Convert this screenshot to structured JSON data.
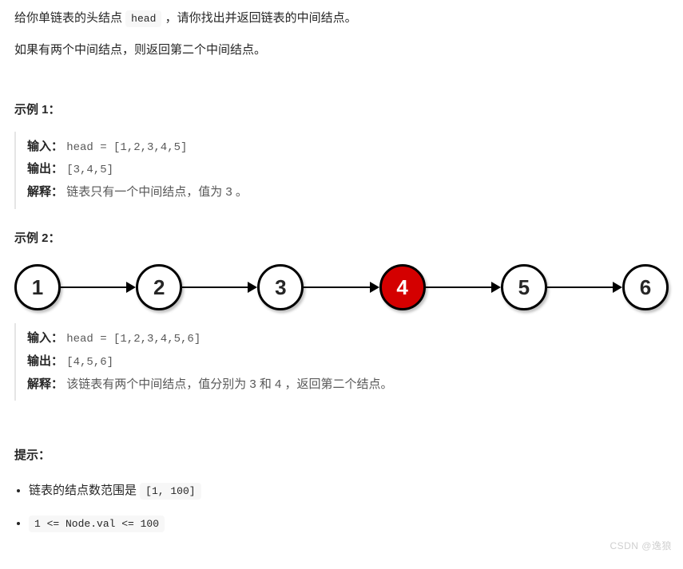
{
  "intro": {
    "p1_pre": "给你单链表的头结点 ",
    "p1_code": "head",
    "p1_post": " ，请你找出并返回链表的中间结点。",
    "p2": "如果有两个中间结点，则返回第二个中间结点。"
  },
  "example1": {
    "title": "示例 1：",
    "input_label": "输入：",
    "input_value": "head = [1,2,3,4,5]",
    "output_label": "输出：",
    "output_value": "[3,4,5]",
    "explain_label": "解释：",
    "explain_text": "链表只有一个中间结点，值为 3 。"
  },
  "example2": {
    "title": "示例 2：",
    "input_label": "输入：",
    "input_value": "head = [1,2,3,4,5,6]",
    "output_label": "输出：",
    "output_value": "[4,5,6]",
    "explain_label": "解释：",
    "explain_text": "该链表有两个中间结点，值分别为 3 和 4 ，返回第二个结点。"
  },
  "diagram": {
    "nodes": [
      "1",
      "2",
      "3",
      "4",
      "5",
      "6"
    ],
    "highlight_index": 3
  },
  "hints": {
    "title": "提示：",
    "item1_pre": "链表的结点数范围是 ",
    "item1_code": "[1, 100]",
    "item2_code": "1 <= Node.val <= 100"
  },
  "watermark": "CSDN @逸狼"
}
